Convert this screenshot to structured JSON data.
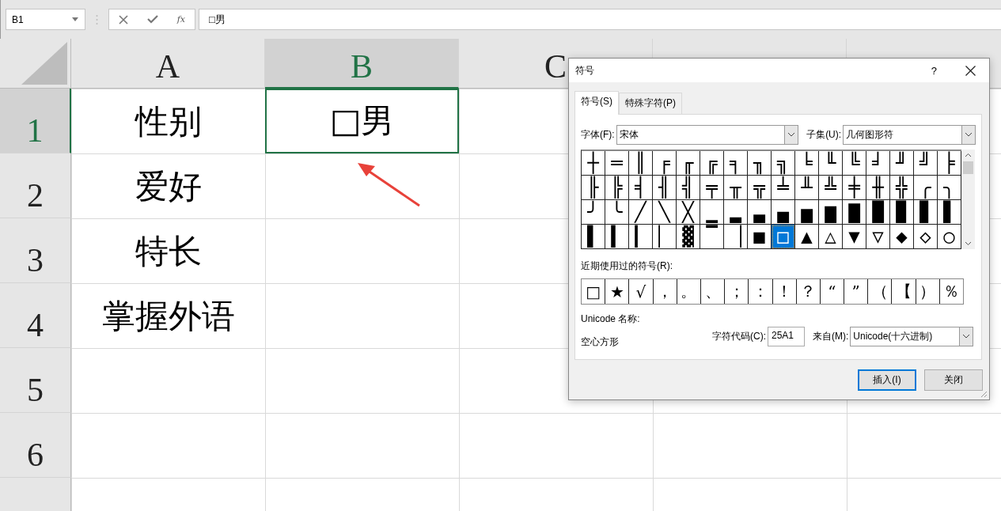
{
  "formula_bar": {
    "name_box": "B1",
    "function_label": "fx",
    "value": "□男"
  },
  "sheet": {
    "columns": [
      {
        "label": "A",
        "selected": false
      },
      {
        "label": "B",
        "selected": true
      },
      {
        "label": "C",
        "selected": false
      },
      {
        "selected": false
      },
      {
        "selected": false
      }
    ],
    "rows": [
      {
        "label": "1",
        "selected": true,
        "cells": [
          {
            "text": "性别",
            "selected": false
          },
          {
            "text": "□男",
            "selected": true
          }
        ]
      },
      {
        "label": "2",
        "selected": false,
        "cells": [
          {
            "text": "爱好",
            "selected": false
          },
          {
            "selected": false
          }
        ]
      },
      {
        "label": "3",
        "selected": false,
        "cells": [
          {
            "text": "特长",
            "selected": false
          },
          {
            "selected": false
          }
        ]
      },
      {
        "label": "4",
        "selected": false,
        "cells": [
          {
            "text": "掌握外语",
            "selected": false
          },
          {
            "selected": false
          }
        ]
      },
      {
        "label": "5",
        "selected": false,
        "cells": [
          {
            "selected": false
          },
          {
            "selected": false
          }
        ]
      },
      {
        "label": "6",
        "selected": false,
        "cells": [
          {
            "selected": false
          },
          {
            "selected": false
          }
        ]
      },
      {
        "selected": false,
        "cells": [
          {
            "selected": false
          },
          {
            "selected": false
          }
        ]
      }
    ]
  },
  "dialog": {
    "title": "符号",
    "help": "?",
    "tabs": [
      {
        "label": "符号(S)",
        "selected": true
      },
      {
        "label": "特殊字符(P)",
        "selected": false
      }
    ],
    "font_label": "字体(F):",
    "font_value": "宋体",
    "subset_label": "子集(U):",
    "subset_value": "几何图形符",
    "symbols": [
      [
        {
          "char": "┼",
          "selected": false
        },
        {
          "char": "═",
          "selected": false
        },
        {
          "char": "║",
          "selected": false
        },
        {
          "char": "╒",
          "selected": false
        },
        {
          "char": "╓",
          "selected": false
        },
        {
          "char": "╔",
          "selected": false
        },
        {
          "char": "╕",
          "selected": false
        },
        {
          "char": "╖",
          "selected": false
        },
        {
          "char": "╗",
          "selected": false
        },
        {
          "char": "╘",
          "selected": false
        },
        {
          "char": "╙",
          "selected": false
        },
        {
          "char": "╚",
          "selected": false
        },
        {
          "char": "╛",
          "selected": false
        },
        {
          "char": "╜",
          "selected": false
        },
        {
          "char": "╝",
          "selected": false
        },
        {
          "char": "╞",
          "selected": false
        }
      ],
      [
        {
          "char": "╟",
          "selected": false
        },
        {
          "char": "╠",
          "selected": false
        },
        {
          "char": "╡",
          "selected": false
        },
        {
          "char": "╢",
          "selected": false
        },
        {
          "char": "╣",
          "selected": false
        },
        {
          "char": "╤",
          "selected": false
        },
        {
          "char": "╥",
          "selected": false
        },
        {
          "char": "╦",
          "selected": false
        },
        {
          "char": "╧",
          "selected": false
        },
        {
          "char": "╨",
          "selected": false
        },
        {
          "char": "╩",
          "selected": false
        },
        {
          "char": "╪",
          "selected": false
        },
        {
          "char": "╫",
          "selected": false
        },
        {
          "char": "╬",
          "selected": false
        },
        {
          "char": "╭",
          "selected": false
        },
        {
          "char": "╮",
          "selected": false
        }
      ],
      [
        {
          "char": "╯",
          "selected": false
        },
        {
          "char": "╰",
          "selected": false
        },
        {
          "char": "╱",
          "selected": false
        },
        {
          "char": "╲",
          "selected": false
        },
        {
          "char": "╳",
          "selected": false
        },
        {
          "char": "▁",
          "selected": false
        },
        {
          "char": "▂",
          "selected": false
        },
        {
          "char": "▃",
          "selected": false
        },
        {
          "char": "▄",
          "selected": false
        },
        {
          "char": "▅",
          "selected": false
        },
        {
          "char": "▆",
          "selected": false
        },
        {
          "char": "▇",
          "selected": false
        },
        {
          "char": "█",
          "selected": false
        },
        {
          "char": "▉",
          "selected": false
        },
        {
          "char": "▊",
          "selected": false
        },
        {
          "char": "▋",
          "selected": false
        }
      ],
      [
        {
          "char": "▌",
          "selected": false
        },
        {
          "char": "▍",
          "selected": false
        },
        {
          "char": "▎",
          "selected": false
        },
        {
          "char": "▏",
          "selected": false
        },
        {
          "char": "▓",
          "selected": false
        },
        {
          "char": "▔",
          "selected": false
        },
        {
          "char": "▕",
          "selected": false
        },
        {
          "char": "■",
          "selected": false
        },
        {
          "char": "□",
          "selected": true
        },
        {
          "char": "▲",
          "selected": false
        },
        {
          "char": "△",
          "selected": false
        },
        {
          "char": "▼",
          "selected": false
        },
        {
          "char": "▽",
          "selected": false
        },
        {
          "char": "◆",
          "selected": false
        },
        {
          "char": "◇",
          "selected": false
        },
        {
          "char": "○",
          "selected": false
        }
      ]
    ],
    "recent_label": "近期使用过的符号(R):",
    "recent": [
      "□",
      "★",
      "√",
      "，",
      "。",
      "、",
      "；",
      "：",
      "！",
      "？",
      "“",
      "”",
      "（",
      "【",
      "）",
      "％"
    ],
    "unicode_name_label": "Unicode 名称:",
    "unicode_name": "空心方形",
    "char_code_label": "字符代码(C):",
    "char_code": "25A1",
    "from_label": "来自(M):",
    "from_value": "Unicode(十六进制)",
    "buttons": [
      {
        "label": "插入(I)",
        "default": true
      },
      {
        "label": "关闭",
        "default": false
      }
    ]
  }
}
